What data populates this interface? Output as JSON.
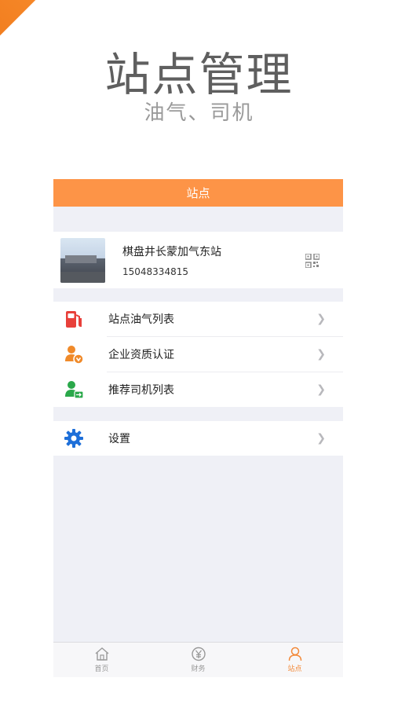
{
  "promo": {
    "title": "站点管理",
    "subtitle": "油气、司机"
  },
  "navbar": {
    "title": "站点"
  },
  "station": {
    "name": "棋盘井长蒙加气东站",
    "phone": "15048334815"
  },
  "menu": [
    {
      "label": "站点油气列表",
      "icon": "fuel-pump-icon"
    },
    {
      "label": "企业资质认证",
      "icon": "verified-user-icon"
    },
    {
      "label": "推荐司机列表",
      "icon": "user-share-icon"
    }
  ],
  "settings": {
    "label": "设置",
    "icon": "gear-icon"
  },
  "tabs": [
    {
      "label": "首页",
      "icon": "home-icon"
    },
    {
      "label": "财务",
      "icon": "yen-icon"
    },
    {
      "label": "站点",
      "icon": "person-icon"
    }
  ],
  "colors": {
    "accent": "#fd9447",
    "gear": "#1e6fd9",
    "fuel": "#e8403a",
    "verify": "#f08a2a",
    "share": "#2aa84a"
  }
}
